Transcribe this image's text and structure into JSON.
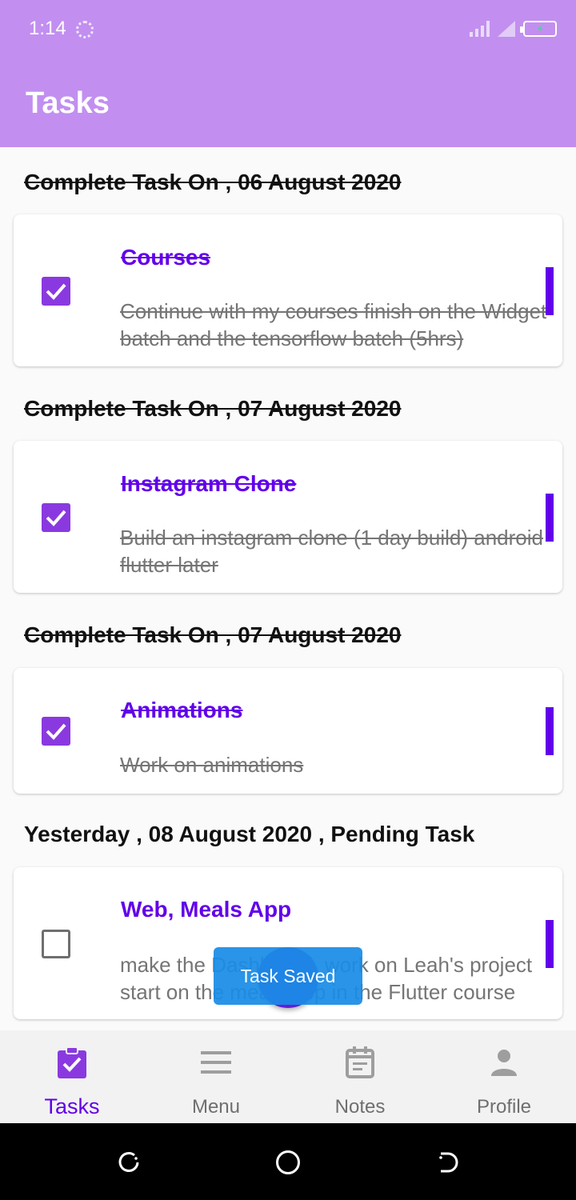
{
  "status_bar": {
    "time": "1:14"
  },
  "app_bar": {
    "title": "Tasks"
  },
  "sections": [
    {
      "heading": "Complete Task On , 06 August 2020 ",
      "completed": true,
      "task": {
        "title": "Courses",
        "description_lines": [
          "Continue with my courses finish on the Widget",
          "batch and the tensorflow batch (5hrs)"
        ],
        "checked": true
      }
    },
    {
      "heading": "Complete Task On , 07 August 2020 ",
      "completed": true,
      "task": {
        "title": "Instagram Clone",
        "description_lines": [
          "Build an instagram clone (1 day build) android",
          "flutter later "
        ],
        "checked": true
      }
    },
    {
      "heading": "Complete Task On , 07 August 2020 ",
      "completed": true,
      "task": {
        "title": "Animations",
        "description_lines": [
          "Work on animations "
        ],
        "checked": true
      }
    },
    {
      "heading": "Yesterday , 08 August 2020 , Pending Task",
      "completed": false,
      "task": {
        "title": "Web, Meals App",
        "description_lines": [
          "make the Dashboard, work on Leah's project",
          "start on the meals app in the Flutter course"
        ],
        "checked": false
      }
    }
  ],
  "toast": {
    "message": "Task Saved"
  },
  "bottom_nav": {
    "items": [
      {
        "label": "Tasks",
        "icon": "task-clipboard-icon",
        "active": true
      },
      {
        "label": "Menu",
        "icon": "menu-icon",
        "active": false
      },
      {
        "label": "Notes",
        "icon": "calendar-notes-icon",
        "active": false
      },
      {
        "label": "Profile",
        "icon": "person-icon",
        "active": false
      }
    ]
  },
  "colors": {
    "primary": "#6200ea",
    "app_bar": "#c28ff0",
    "checkbox": "#8a39e0",
    "toast": "#1e88e5",
    "fab": "#6a1bd6"
  }
}
